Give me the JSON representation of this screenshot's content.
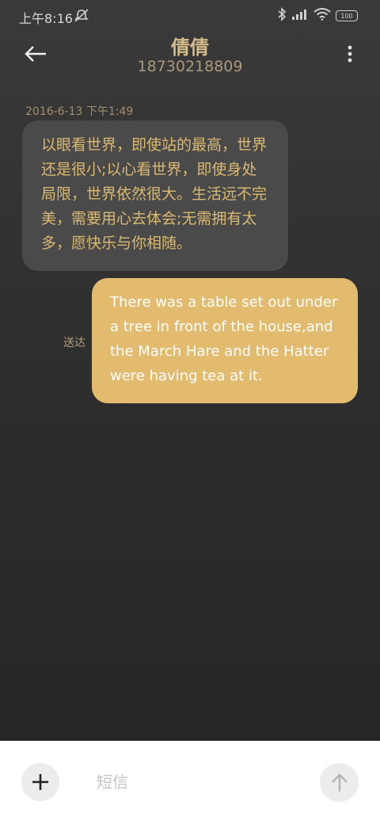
{
  "status_bar": {
    "time": "上午8:16",
    "battery": "100"
  },
  "header": {
    "contact_name": "倩倩",
    "contact_number": "18730218809"
  },
  "conversation": {
    "timestamp": "2016-6-13 下午1:49",
    "incoming_message": "以眼看世界，即使站的最高，世界还是很小;以心看世界，即使身处局限，世界依然很大。生活远不完美，需要用心去体会;无需拥有太多，愿快乐与你相随。",
    "outgoing_message": "There was a table set out under a tree in front of the house,and the March Hare and the Hatter were having tea at it.",
    "outgoing_status": "送达"
  },
  "input_bar": {
    "placeholder": "短信"
  },
  "icons": {
    "back": "back-arrow-icon",
    "more": "more-vert-icon",
    "add": "plus-icon",
    "send": "arrow-up-icon",
    "dnd": "do-not-disturb-icon",
    "bluetooth": "bluetooth-icon",
    "signal": "signal-icon",
    "wifi": "wifi-icon"
  },
  "colors": {
    "accent_gold": "#e2bb6e",
    "incoming_bubble": "#4a4a4a",
    "incoming_text": "#dbb96f"
  }
}
